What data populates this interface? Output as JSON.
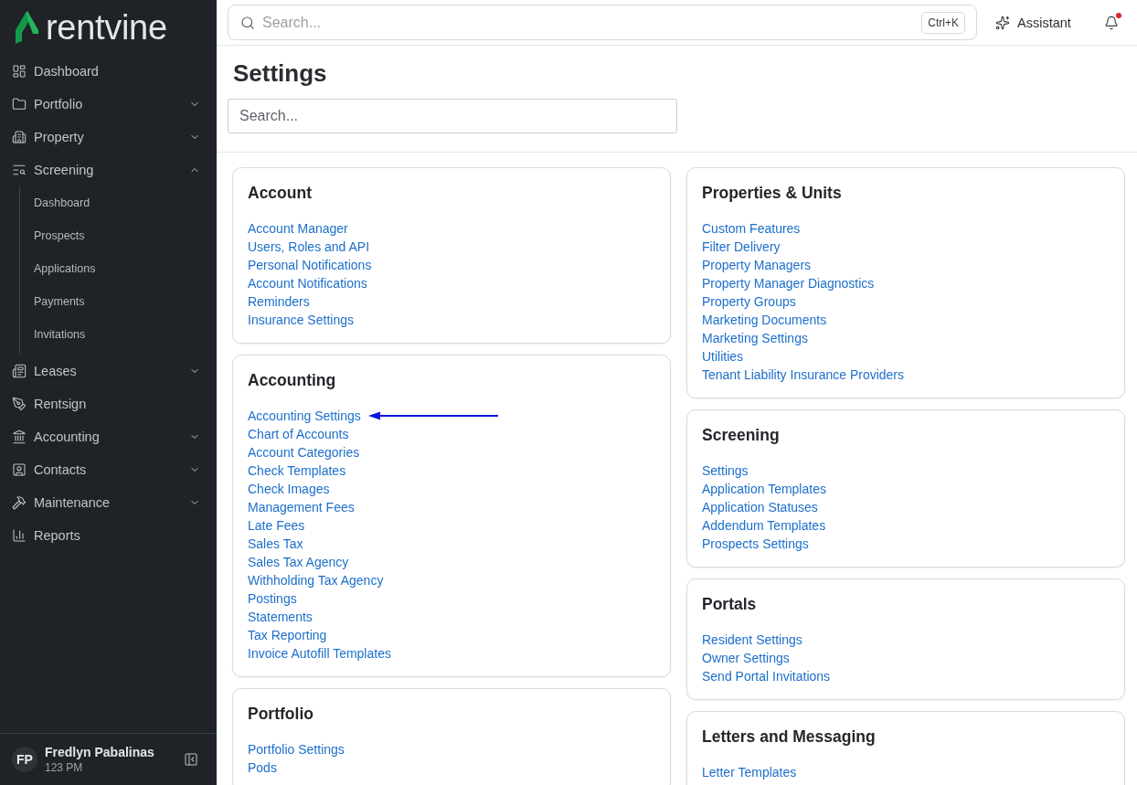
{
  "sidebar": {
    "logo": {
      "text": "rentvine"
    },
    "nav": [
      {
        "label": "Dashboard",
        "kind": "link"
      },
      {
        "label": "Portfolio",
        "kind": "group",
        "expanded": false
      },
      {
        "label": "Property",
        "kind": "group",
        "expanded": false
      },
      {
        "label": "Screening",
        "kind": "group",
        "expanded": true,
        "children": [
          {
            "label": "Dashboard"
          },
          {
            "label": "Prospects"
          },
          {
            "label": "Applications"
          },
          {
            "label": "Payments"
          },
          {
            "label": "Invitations"
          }
        ]
      },
      {
        "label": "Leases",
        "kind": "group",
        "expanded": false
      },
      {
        "label": "Rentsign",
        "kind": "link"
      },
      {
        "label": "Accounting",
        "kind": "group",
        "expanded": false
      },
      {
        "label": "Contacts",
        "kind": "group",
        "expanded": false
      },
      {
        "label": "Maintenance",
        "kind": "group",
        "expanded": false
      },
      {
        "label": "Reports",
        "kind": "link"
      }
    ],
    "user": {
      "initials": "FP",
      "name": "Fredlyn Pabalinas",
      "detail": "123 PM"
    }
  },
  "topbar": {
    "search": {
      "placeholder": "Search...",
      "shortcut": "Ctrl+K"
    },
    "assistant": "Assistant",
    "notifications": {
      "unread": true
    }
  },
  "page": {
    "title": "Settings",
    "search": {
      "placeholder": "Search..."
    }
  },
  "columns": [
    {
      "cards": [
        {
          "title": "Account",
          "links": [
            {
              "label": "Account Manager",
              "arrow": false
            },
            {
              "label": "Users, Roles and API",
              "arrow": false
            },
            {
              "label": "Personal Notifications",
              "arrow": false
            },
            {
              "label": "Account Notifications",
              "arrow": false
            },
            {
              "label": "Reminders",
              "arrow": false
            },
            {
              "label": "Insurance Settings",
              "arrow": false
            }
          ]
        },
        {
          "title": "Accounting",
          "links": [
            {
              "label": "Accounting Settings",
              "arrow": true
            },
            {
              "label": "Chart of Accounts",
              "arrow": false
            },
            {
              "label": "Account Categories",
              "arrow": false
            },
            {
              "label": "Check Templates",
              "arrow": false
            },
            {
              "label": "Check Images",
              "arrow": false
            },
            {
              "label": "Management Fees",
              "arrow": false
            },
            {
              "label": "Late Fees",
              "arrow": false
            },
            {
              "label": "Sales Tax",
              "arrow": false
            },
            {
              "label": "Sales Tax Agency",
              "arrow": false
            },
            {
              "label": "Withholding Tax Agency",
              "arrow": false
            },
            {
              "label": "Postings",
              "arrow": false
            },
            {
              "label": "Statements",
              "arrow": false
            },
            {
              "label": "Tax Reporting",
              "arrow": false
            },
            {
              "label": "Invoice Autofill Templates",
              "arrow": false
            }
          ]
        },
        {
          "title": "Portfolio",
          "links": [
            {
              "label": "Portfolio Settings",
              "arrow": false
            },
            {
              "label": "Pods",
              "arrow": false
            }
          ]
        }
      ]
    },
    {
      "cards": [
        {
          "title": "Properties & Units",
          "links": [
            {
              "label": "Custom Features",
              "arrow": false
            },
            {
              "label": "Filter Delivery",
              "arrow": false
            },
            {
              "label": "Property Managers",
              "arrow": false
            },
            {
              "label": "Property Manager Diagnostics",
              "arrow": false
            },
            {
              "label": "Property Groups",
              "arrow": false
            },
            {
              "label": "Marketing Documents",
              "arrow": false
            },
            {
              "label": "Marketing Settings",
              "arrow": false
            },
            {
              "label": "Utilities",
              "arrow": false
            },
            {
              "label": "Tenant Liability Insurance Providers",
              "arrow": false
            }
          ]
        },
        {
          "title": "Screening",
          "links": [
            {
              "label": "Settings",
              "arrow": false
            },
            {
              "label": "Application Templates",
              "arrow": false
            },
            {
              "label": "Application Statuses",
              "arrow": false
            },
            {
              "label": "Addendum Templates",
              "arrow": false
            },
            {
              "label": "Prospects Settings",
              "arrow": false
            }
          ]
        },
        {
          "title": "Portals",
          "links": [
            {
              "label": "Resident Settings",
              "arrow": false
            },
            {
              "label": "Owner Settings",
              "arrow": false
            },
            {
              "label": "Send Portal Invitations",
              "arrow": false
            }
          ]
        },
        {
          "title": "Letters and Messaging",
          "links": [
            {
              "label": "Letter Templates",
              "arrow": false
            }
          ]
        }
      ]
    }
  ]
}
